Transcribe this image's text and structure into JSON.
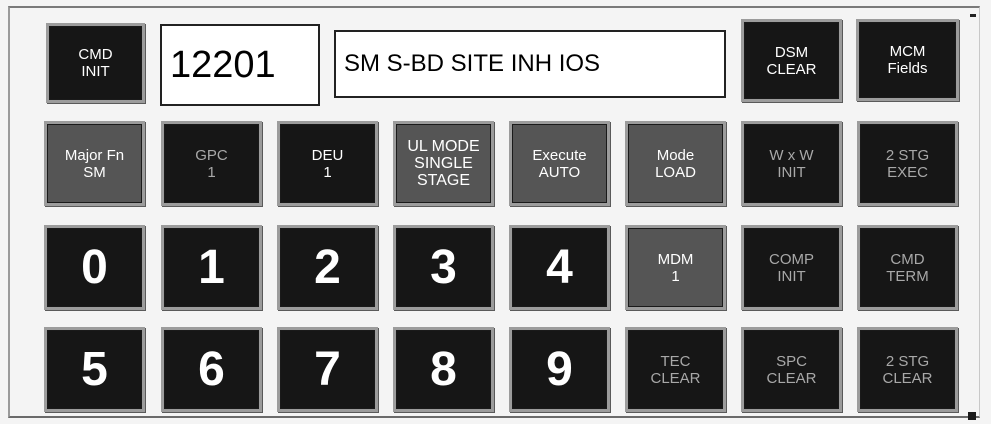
{
  "display": {
    "id_value": "12201",
    "message": "SM S-BD SITE INH IOS"
  },
  "row1": {
    "cmd_init": "CMD\nINIT",
    "dsm_clear": "DSM\nCLEAR",
    "mcm_fields": "MCM\nFields"
  },
  "row2": {
    "major_fn": "Major Fn\nSM",
    "gpc": "GPC\n1",
    "deu": "DEU\n1",
    "ul_mode": "UL MODE\nSINGLE\nSTAGE",
    "execute": "Execute\nAUTO",
    "mode": "Mode\nLOAD",
    "wxw": "W x W\nINIT",
    "stg_exec": "2 STG\nEXEC"
  },
  "row3": {
    "digits": [
      "0",
      "1",
      "2",
      "3",
      "4"
    ],
    "mdm": "MDM\n1",
    "comp_init": "COMP\nINIT",
    "cmd_term": "CMD\nTERM"
  },
  "row4": {
    "digits": [
      "5",
      "6",
      "7",
      "8",
      "9"
    ],
    "tec_clear": "TEC\nCLEAR",
    "spc_clear": "SPC\nCLEAR",
    "stg_clear": "2 STG\nCLEAR"
  }
}
